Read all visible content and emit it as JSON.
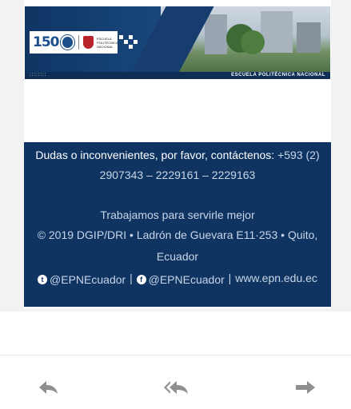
{
  "banner": {
    "logo_number": "150",
    "logo_text": "ESCUELA POLITÉCNICA NACIONAL",
    "strip_dots": "::::::::",
    "caption": "ESCUELA POLITÉCNICA NACIONAL"
  },
  "footer": {
    "contact_label": "Dudas o inconvenientes, por favor, contáctenos:",
    "phone_first": "+593 (2)",
    "phone_numbers": "2907343 – 2229161 – 2229163",
    "tagline": "Trabajamos para servirle mejor",
    "address_line1": "© 2019 DGIP/DRI • Ladrón de Guevara E11·253 • Quito,",
    "address_line2": "Ecuador",
    "twitter_handle": "@EPNEcuador",
    "sep1": "|",
    "facebook_handle": "@EPNEcuador",
    "sep2": "|",
    "website": "www.epn.edu.ec"
  },
  "actions": {
    "reply_icon": "reply-icon",
    "reply_all_icon": "reply-all-icon",
    "forward_icon": "forward-icon"
  },
  "colors": {
    "footer_bg": "#0f3462",
    "icon_gray": "#8f8f8f"
  }
}
